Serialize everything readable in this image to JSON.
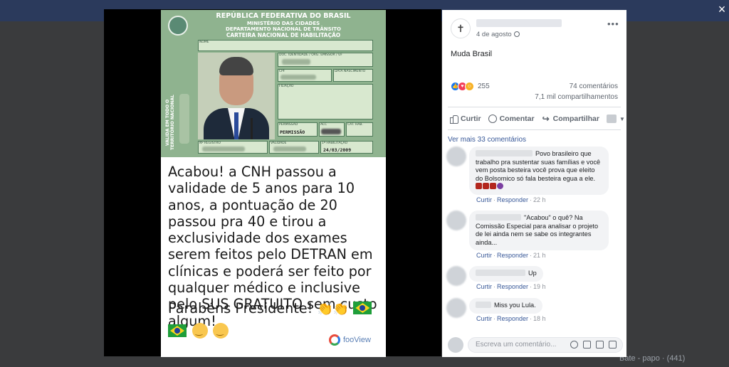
{
  "close_icon": "×",
  "background": {
    "bottom_text": "Bate - papo · (441)"
  },
  "image": {
    "license": {
      "line1": "REPÚBLICA FEDERATIVA DO BRASIL",
      "line2": "MINISTÉRIO DAS CIDADES",
      "line3": "DEPARTAMENTO NACIONAL DE TRÂNSITO",
      "line4": "CARTEIRA NACIONAL DE HABILITAÇÃO",
      "side_label": "VÁLIDA EM TODO O TERRITÓRIO NACIONAL",
      "labels": {
        "nome": "NOME",
        "doc": "DOC. IDENTIDADE / ÓRG. EMISSOR / UF",
        "cpf": "CPF",
        "nascimento": "DATA NASCIMENTO",
        "filiacao": "FILIAÇÃO",
        "permissao": "PERMISSÃO",
        "acc": "ACC",
        "cat": "CAT. HAB.",
        "registro": "Nº REGISTRO",
        "validade": "VALIDADE",
        "primeira": "1ª HABILITAÇÃO"
      },
      "values": {
        "permissao": "PERMISSÃO",
        "primeira": "24/03/2009"
      }
    },
    "caption": "Acabou! a CNH passou a validade de 5 anos para 10 anos, a pontuação de 20 passou pra 40 e tirou a exclusividade dos exames serem feitos pelo DETRAN em clínicas e poderá ser feito por qualquer médico e inclusive pelo SUS GRATUITO sem custo algum!",
    "caption2": "Parabéns Presidente!",
    "watermark": "fooView"
  },
  "post": {
    "date": "4 de agosto",
    "text": "Muda Brasil",
    "reaction_count": "255",
    "comments_count": "74 comentários",
    "shares_count": "7,1 mil compartilhamentos",
    "actions": {
      "like": "Curtir",
      "comment": "Comentar",
      "share": "Compartilhar"
    },
    "more_comments": "Ver mais 33 comentários",
    "comments": [
      {
        "text": "Povo brasileiro que trabalho pra sustentar suas famílias e você vem posta besteira você prova que eleito do Bolsomico só fala besteira egua a ele.",
        "like": "Curtir",
        "reply": "Responder",
        "time": "22 h"
      },
      {
        "text": "\"Acabou\" o quê? Na Comissão Especial para analisar o projeto de lei ainda nem se sabe os integrantes ainda...",
        "like": "Curtir",
        "reply": "Responder",
        "time": "21 h"
      },
      {
        "text": "Up",
        "like": "Curtir",
        "reply": "Responder",
        "time": "19 h"
      },
      {
        "text": "Miss you Lula.",
        "like": "Curtir",
        "reply": "Responder",
        "time": "18 h"
      }
    ],
    "write_placeholder": "Escreva um comentário..."
  }
}
